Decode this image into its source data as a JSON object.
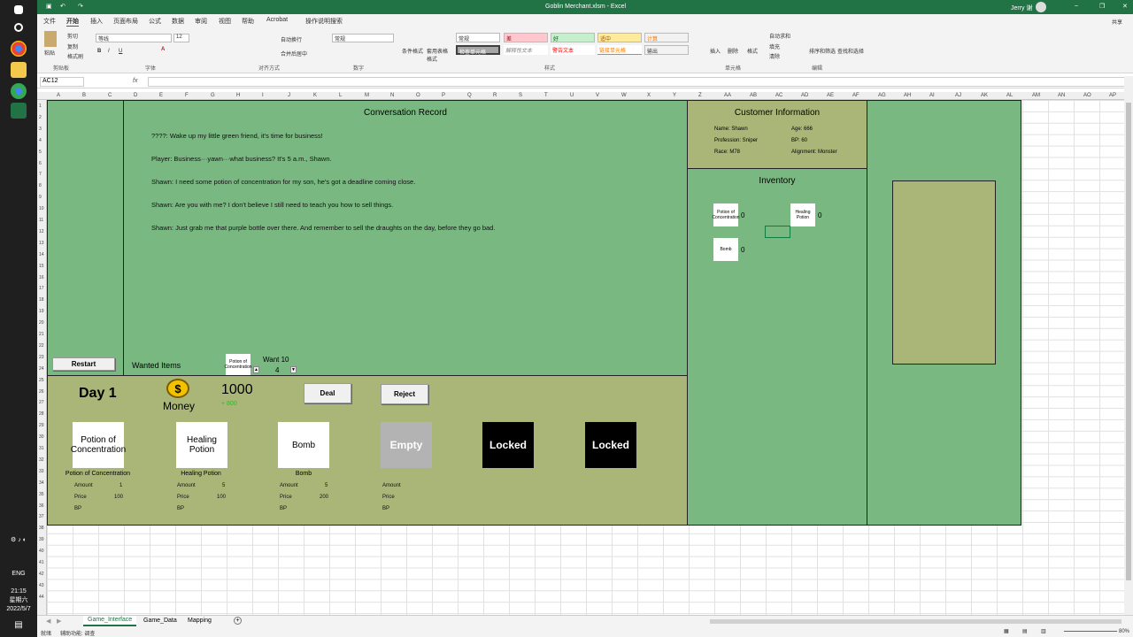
{
  "window": {
    "title": "Goblin Merchant.xlsm  -  Excel",
    "user": "Jerry 谢"
  },
  "ribbon_tabs": [
    "文件",
    "开始",
    "插入",
    "页面布局",
    "公式",
    "数据",
    "审阅",
    "视图",
    "帮助",
    "Acrobat",
    "操作说明搜索"
  ],
  "ribbon": {
    "clipboard": {
      "paste": "粘贴",
      "cut": "剪切",
      "copy": "复制",
      "format_painter": "格式刷",
      "label": "剪贴板"
    },
    "font": {
      "name": "等线",
      "size": "12",
      "label": "字体"
    },
    "alignment": {
      "wrap": "自动换行",
      "merge": "合并后居中",
      "label": "对齐方式"
    },
    "number": {
      "format": "常规",
      "label": "数字"
    },
    "styles": {
      "conditional": "条件格式",
      "table": "套用表格格式",
      "normal": "常规",
      "bad": "差",
      "good": "好",
      "neutral": "适中",
      "calc": "计算",
      "check": "检查单元格",
      "explain": "解释性文本",
      "warn": "警告文本",
      "link": "链接单元格",
      "output": "输出",
      "label": "样式"
    },
    "cells": {
      "insert": "插入",
      "delete": "删除",
      "format": "格式",
      "label": "单元格"
    },
    "editing": {
      "autosum": "自动求和",
      "fill": "填充",
      "clear": "清除",
      "sort": "排序和筛选",
      "find": "查找和选择",
      "label": "编辑"
    },
    "share": "共享"
  },
  "formula_bar": {
    "name_box": "AC12",
    "fx": "fx"
  },
  "columns": [
    "A",
    "B",
    "C",
    "D",
    "E",
    "F",
    "G",
    "H",
    "I",
    "J",
    "K",
    "L",
    "M",
    "N",
    "O",
    "P",
    "Q",
    "R",
    "S",
    "T",
    "U",
    "V",
    "W",
    "X",
    "Y",
    "Z",
    "AA",
    "AB",
    "AC",
    "AD",
    "AE",
    "AF",
    "AG",
    "AH",
    "AI",
    "AJ",
    "AK",
    "AL",
    "AM",
    "AN",
    "AO",
    "AP"
  ],
  "rows": [
    "1",
    "2",
    "3",
    "4",
    "5",
    "6",
    "7",
    "8",
    "9",
    "10",
    "11",
    "12",
    "13",
    "14",
    "15",
    "16",
    "17",
    "18",
    "19",
    "20",
    "21",
    "22",
    "23",
    "24",
    "25",
    "26",
    "27",
    "28",
    "29",
    "30",
    "31",
    "32",
    "33",
    "34",
    "35",
    "36",
    "37",
    "38",
    "39",
    "40",
    "41",
    "42",
    "43",
    "44"
  ],
  "game": {
    "restart_label": "Restart",
    "conversation": {
      "title": "Conversation Record",
      "lines": [
        "????: Wake up my little green friend, it's time for business!",
        "Player: Business···yawn···what business? It's 5 a.m., Shawn.",
        "Shawn: I need some potion of concentration for my son, he's got a deadline coming close.",
        "Shawn: Are you with me? I don't believe I still need to teach you how to sell things.",
        "Shawn: Just grab me that purple bottle over there. And remember to sell the draughts on the day, before they go bad."
      ]
    },
    "wanted": {
      "label": "Wanted Items",
      "item": "Potion of Concentration",
      "want_label": "Want 10",
      "count": "4"
    },
    "customer": {
      "title": "Customer Information",
      "name": "Name: Shawn",
      "age": "Age: 666",
      "profession": "Profession: Sniper",
      "bp": "BP: 60",
      "race": "Race: M78",
      "alignment": "Alignment: Monster"
    },
    "inventory": {
      "title": "Inventory",
      "items": [
        {
          "name": "Potion of Concentration",
          "count": "0"
        },
        {
          "name": "Healing Potion",
          "count": "0"
        },
        {
          "name": "Bomb",
          "count": "0"
        }
      ]
    },
    "day_label": "Day 1",
    "money_label": "Money",
    "coin_symbol": "$",
    "money_value": "1000",
    "money_delta": "+ 800",
    "deal_label": "Deal",
    "reject_label": "Reject",
    "shelves": [
      {
        "tile": "Potion of Concentration",
        "caption": "Potion of Concentration",
        "amount_label": "Amount",
        "amount": "1",
        "price_label": "Price",
        "price": "100",
        "bp_label": "BP"
      },
      {
        "tile": "Healing Potion",
        "caption": "Healing Potion",
        "amount_label": "Amount",
        "amount": "5",
        "price_label": "Price",
        "price": "100",
        "bp_label": "BP"
      },
      {
        "tile": "Bomb",
        "caption": "Bomb",
        "amount_label": "Amount",
        "amount": "5",
        "price_label": "Price",
        "price": "200",
        "bp_label": "BP"
      },
      {
        "tile": "Empty",
        "caption": "",
        "amount_label": "Amount",
        "amount": "",
        "price_label": "Price",
        "price": "",
        "bp_label": "BP"
      }
    ],
    "locked_label": "Locked"
  },
  "sheet_tabs": [
    "Game_Interface",
    "Game_Data",
    "Mapping"
  ],
  "status": {
    "ready": "就绪",
    "accessibility": "辅助功能: 调查",
    "zoom": "80%"
  },
  "system": {
    "lang": "ENG",
    "time": "21:15",
    "weekday": "星期六",
    "date": "2022/5/7"
  },
  "colors": {
    "green_panel": "#7ab882",
    "olive_panel": "#a9b678",
    "excel_green": "#217346",
    "locked": "#000000",
    "empty_tile": "#b3b3b3"
  }
}
